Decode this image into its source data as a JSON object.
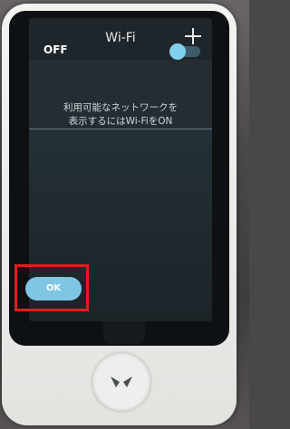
{
  "header": {
    "title": "Wi-Fi",
    "add_icon": "plus-icon"
  },
  "wifi_toggle": {
    "label": "OFF",
    "state": "off"
  },
  "message": {
    "line1": "利用可能なネットワークを",
    "line2": "表示するにはWi-FiをON"
  },
  "ok_button": {
    "label": "OK"
  },
  "colors": {
    "accent": "#7ec6e4",
    "screen_bg": "#252d32",
    "highlight": "#e21c1c"
  }
}
